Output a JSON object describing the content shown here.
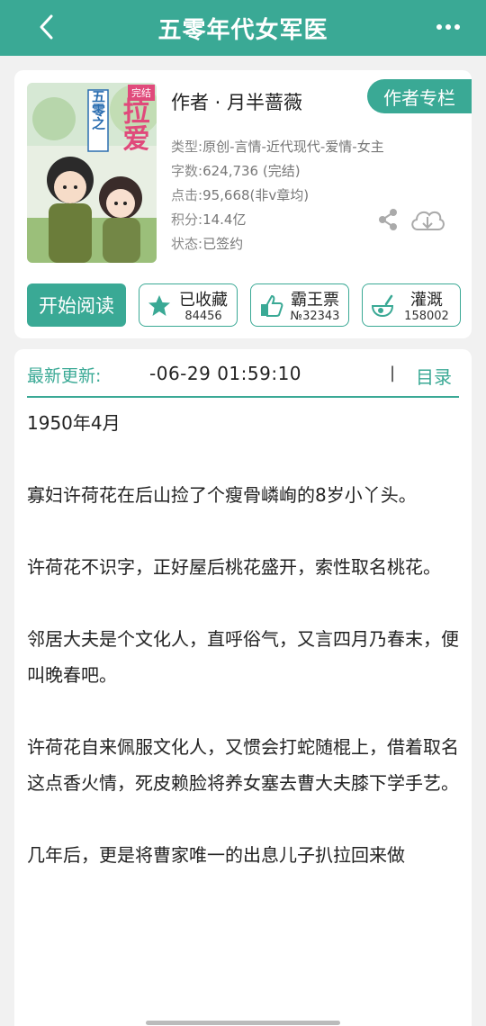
{
  "nav": {
    "title": "五零年代女军医"
  },
  "book": {
    "author_line": "作者 · 月半蔷薇",
    "author_tab": "作者专栏",
    "meta": [
      {
        "key": "类型:",
        "value": "原创-言情-近代现代-爱情-女主"
      },
      {
        "key": "字数:",
        "value": "624,736 (完结)"
      },
      {
        "key": "点击:",
        "value": "95,668(非v章均)"
      },
      {
        "key": "积分:",
        "value": "14.4亿"
      },
      {
        "key": "状态:",
        "value": "已签约"
      }
    ],
    "cover_text": {
      "badge": "完结",
      "vertical_title": "五零之",
      "big_title": "拉爱"
    }
  },
  "buttons": {
    "read": "开始阅读",
    "collect": {
      "label": "已收藏",
      "count": "84456"
    },
    "vote": {
      "label": "霸王票",
      "count": "№32343"
    },
    "water": {
      "label": "灌溉",
      "count": "158002"
    }
  },
  "update": {
    "label": "最新更新:",
    "time": "-06-29 01:59:10",
    "caret": "|",
    "toc": "目录"
  },
  "paragraphs": [
    "1950年4月",
    "寡妇许荷花在后山捡了个瘦骨嶙峋的8岁小丫头。",
    "许荷花不识字，正好屋后桃花盛开，索性取名桃花。",
    "邻居大夫是个文化人，直呼俗气，又言四月乃春末，便叫晚春吧。",
    "许荷花自来佩服文化人，又惯会打蛇随棍上，借着取名这点香火情，死皮赖脸将养女塞去曹大夫膝下学手艺。",
    "几年后，更是将曹家唯一的出息儿子扒拉回来做"
  ],
  "colors": {
    "accent": "#3aa995",
    "background": "#f1f1f1"
  }
}
